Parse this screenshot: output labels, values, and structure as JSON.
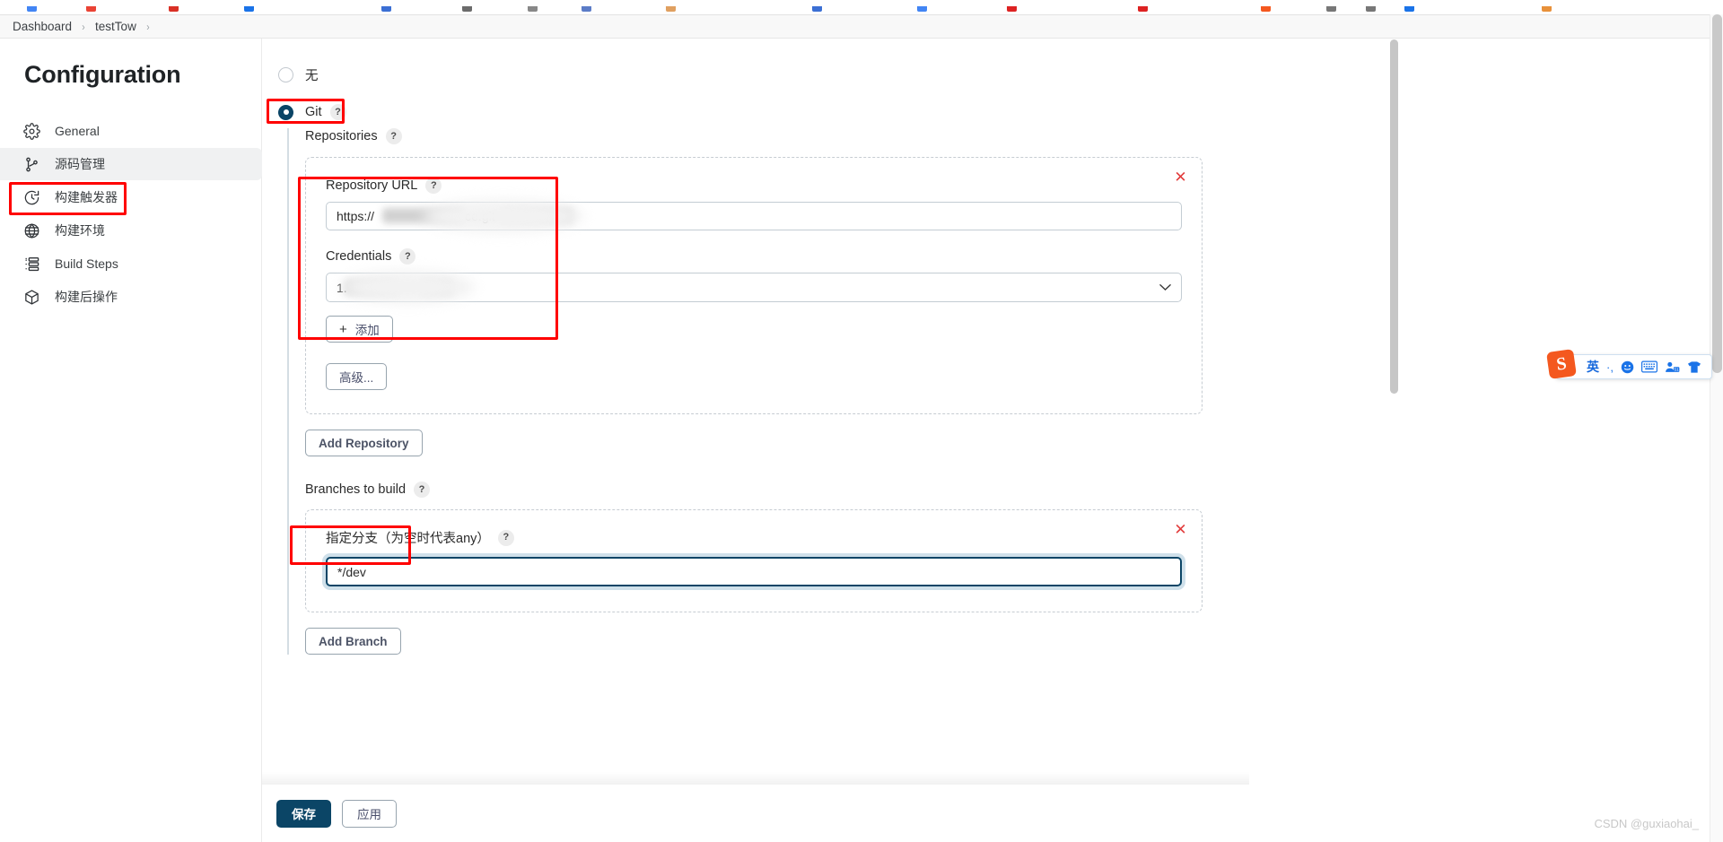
{
  "breadcrumb": {
    "items": [
      "Dashboard",
      "testTow"
    ],
    "separator": "›"
  },
  "sidebar": {
    "title": "Configuration",
    "items": [
      {
        "label": "General",
        "icon": "gear-icon",
        "active": false
      },
      {
        "label": "源码管理",
        "icon": "source-branch-icon",
        "active": true
      },
      {
        "label": "构建触发器",
        "icon": "clock-icon",
        "active": false
      },
      {
        "label": "构建环境",
        "icon": "globe-icon",
        "active": false
      },
      {
        "label": "Build Steps",
        "icon": "list-steps-icon",
        "active": false
      },
      {
        "label": "构建后操作",
        "icon": "package-icon",
        "active": false
      }
    ]
  },
  "scm": {
    "options": [
      {
        "label": "无",
        "checked": false,
        "has_help": false
      },
      {
        "label": "Git",
        "checked": true,
        "has_help": true
      }
    ],
    "help_glyph": "?",
    "repositories_label": "Repositories",
    "repository": {
      "url_label": "Repository URL",
      "url_value": "https://                          ce.git",
      "url_prefix": "https://",
      "url_suffix": "ce.git",
      "credentials_label": "Credentials",
      "credentials_value": "1.",
      "credentials_suffix": "**",
      "add_credentials_label": "添加",
      "add_credentials_plus": "+",
      "advanced_label": "高级...",
      "remove_glyph": "✕"
    },
    "add_repository_label": "Add Repository",
    "branches_label": "Branches to build",
    "branch": {
      "specifier_label": "指定分支（为空时代表any）",
      "value": "*/dev",
      "remove_glyph": "✕"
    },
    "add_branch_label": "Add Branch"
  },
  "footer": {
    "save_label": "保存",
    "apply_label": "应用"
  },
  "ime": {
    "logo": "S",
    "mode": "英",
    "punctuation": "·,",
    "emoji": "☺",
    "keyboard": "⌨",
    "user_badge": "51",
    "skin": "Ŧ"
  },
  "watermark": "CSDN @guxiaohai_",
  "colors": {
    "accent": "#0b4566",
    "annotation": "#ff0000",
    "sidebar_active": "#f0f1f2",
    "border": "#c3ccd3",
    "danger": "#e23c3c"
  }
}
